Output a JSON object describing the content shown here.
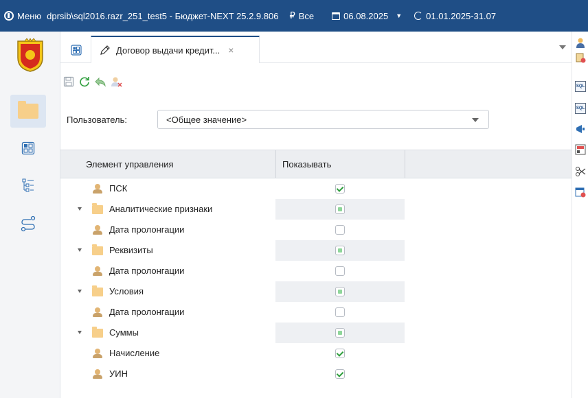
{
  "titlebar": {
    "menu_label": "Меню",
    "path": "dprsib\\sql2016.razr_251_test5 - Бюджет-NEXT 25.2.9.806",
    "filter_symbol": "₽",
    "filter_label": "Все",
    "date": "06.08.2025",
    "period": "01.01.2025-31.07"
  },
  "tab": {
    "label": "Договор выдачи кредит...",
    "close": "×"
  },
  "user_filter": {
    "label": "Пользователь:",
    "value": "<Общее значение>"
  },
  "grid": {
    "columns": [
      "Элемент управления",
      "Показывать"
    ],
    "rows": [
      {
        "label": "ПСК",
        "type": "user",
        "level": 1,
        "state": "checked"
      },
      {
        "label": "Аналитические признаки",
        "type": "folder",
        "level": 0,
        "state": "partial"
      },
      {
        "label": "Дата пролонгации",
        "type": "user",
        "level": 1,
        "state": "unchecked"
      },
      {
        "label": "Реквизиты",
        "type": "folder",
        "level": 0,
        "state": "partial"
      },
      {
        "label": "Дата пролонгации",
        "type": "user",
        "level": 1,
        "state": "unchecked"
      },
      {
        "label": "Условия",
        "type": "folder",
        "level": 0,
        "state": "partial"
      },
      {
        "label": "Дата пролонгации",
        "type": "user",
        "level": 1,
        "state": "unchecked"
      },
      {
        "label": "Суммы",
        "type": "folder",
        "level": 0,
        "state": "partial"
      },
      {
        "label": "Начисление",
        "type": "user",
        "level": 1,
        "state": "checked"
      },
      {
        "label": "УИН",
        "type": "user",
        "level": 1,
        "state": "checked"
      }
    ]
  },
  "colors": {
    "titlebar_bg": "#1f4e86",
    "folder": "#f7cf8a",
    "check_green": "#2e9e3c",
    "header_bg": "#eceef1"
  },
  "icons": {
    "sidebar": [
      "folder-icon",
      "layout-icon",
      "tree-list-icon",
      "route-icon"
    ],
    "toolbar": [
      "save-icon",
      "refresh-icon",
      "undo-icon",
      "user-delete-icon"
    ],
    "rightbar": [
      "user-icon",
      "lock-icon",
      "sql-icon",
      "sql-icon",
      "announce-icon",
      "record-icon",
      "scissors-icon",
      "remove-icon"
    ]
  }
}
